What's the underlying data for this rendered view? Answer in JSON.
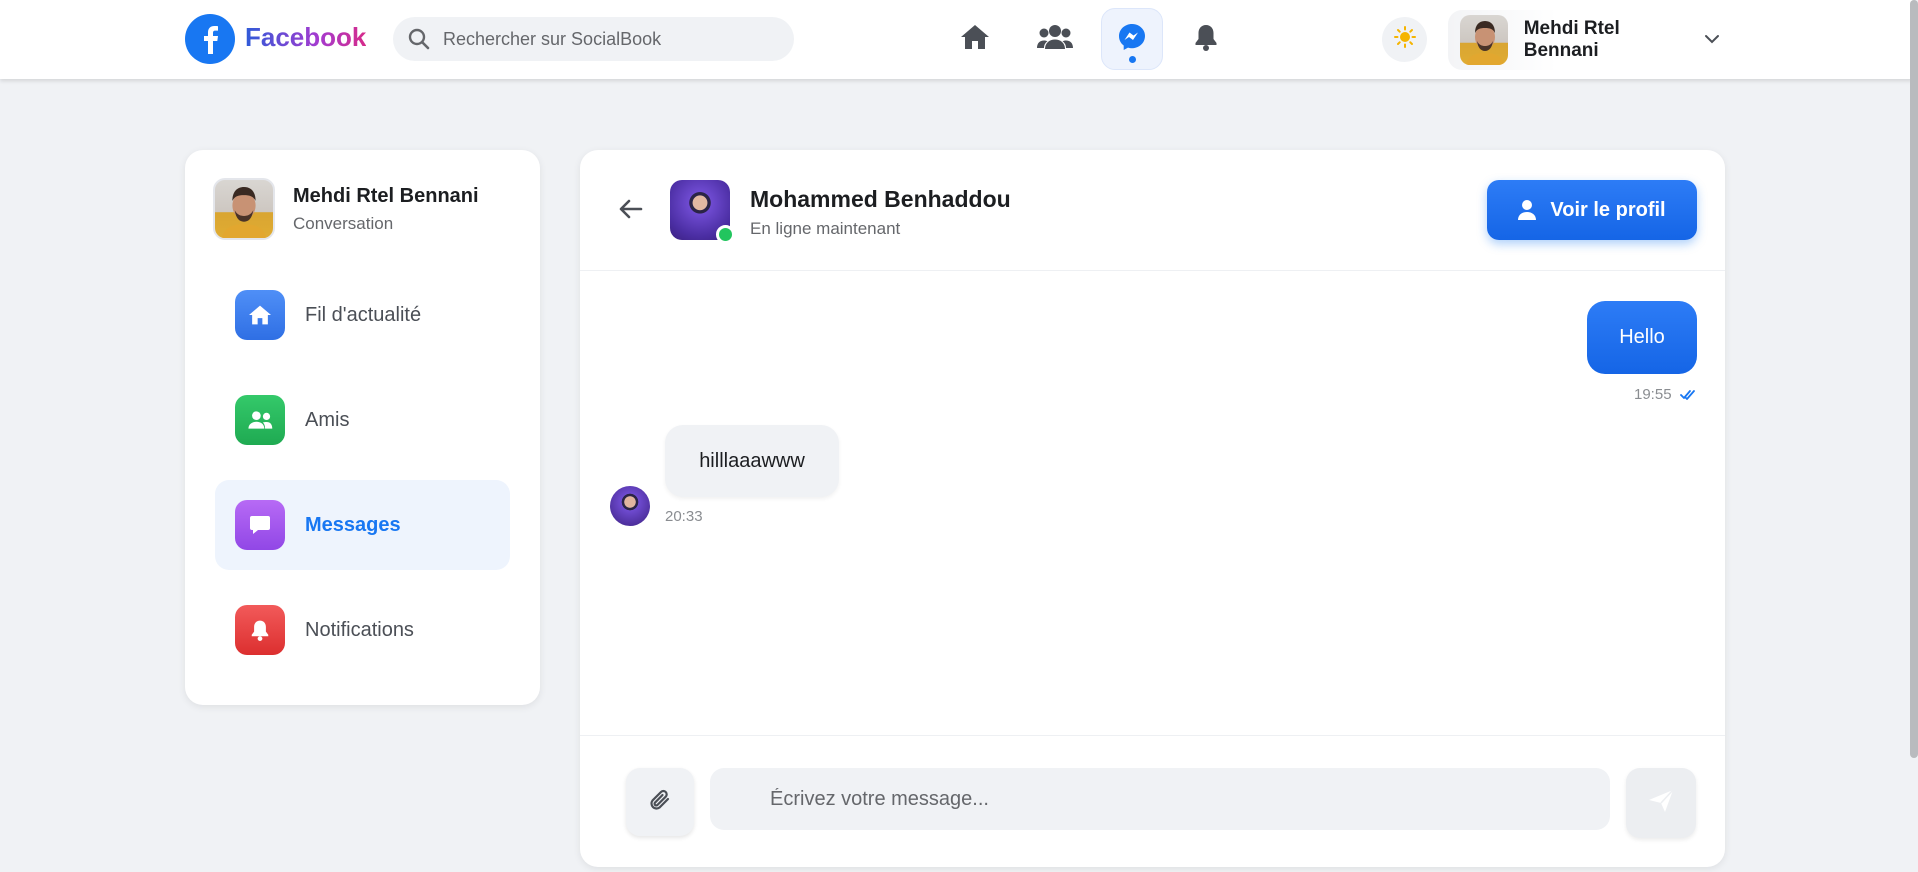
{
  "brand": {
    "name": "Facebook"
  },
  "search": {
    "placeholder": "Rechercher sur SocialBook"
  },
  "nav": {
    "items": [
      {
        "icon": "home-icon"
      },
      {
        "icon": "friends-icon"
      },
      {
        "icon": "messenger-icon",
        "active": true
      },
      {
        "icon": "bell-icon"
      }
    ]
  },
  "user": {
    "name": "Mehdi Rtel Bennani"
  },
  "sidebar": {
    "profile": {
      "name": "Mehdi Rtel Bennani",
      "subtitle": "Conversation"
    },
    "items": [
      {
        "label": "Fil d'actualité",
        "icon": "home-icon",
        "color": "#3b82f6"
      },
      {
        "label": "Amis",
        "icon": "friends-icon",
        "color": "#22c55e"
      },
      {
        "label": "Messages",
        "icon": "message-icon",
        "color": "#a855f7",
        "active": true
      },
      {
        "label": "Notifications",
        "icon": "bell-icon",
        "color": "#ef4444"
      }
    ]
  },
  "chat": {
    "contact": {
      "name": "Mohammed Benhaddou",
      "status": "En ligne maintenant"
    },
    "profile_button": "Voir le profil",
    "messages": [
      {
        "direction": "out",
        "text": "Hello",
        "time": "19:55",
        "read": true
      },
      {
        "direction": "in",
        "text": "hilllaaawww",
        "time": "20:33"
      }
    ],
    "composer": {
      "placeholder": "Écrivez votre message..."
    }
  },
  "colors": {
    "accent": "#1877f2",
    "online": "#22c55e",
    "background": "#f0f2f5"
  }
}
